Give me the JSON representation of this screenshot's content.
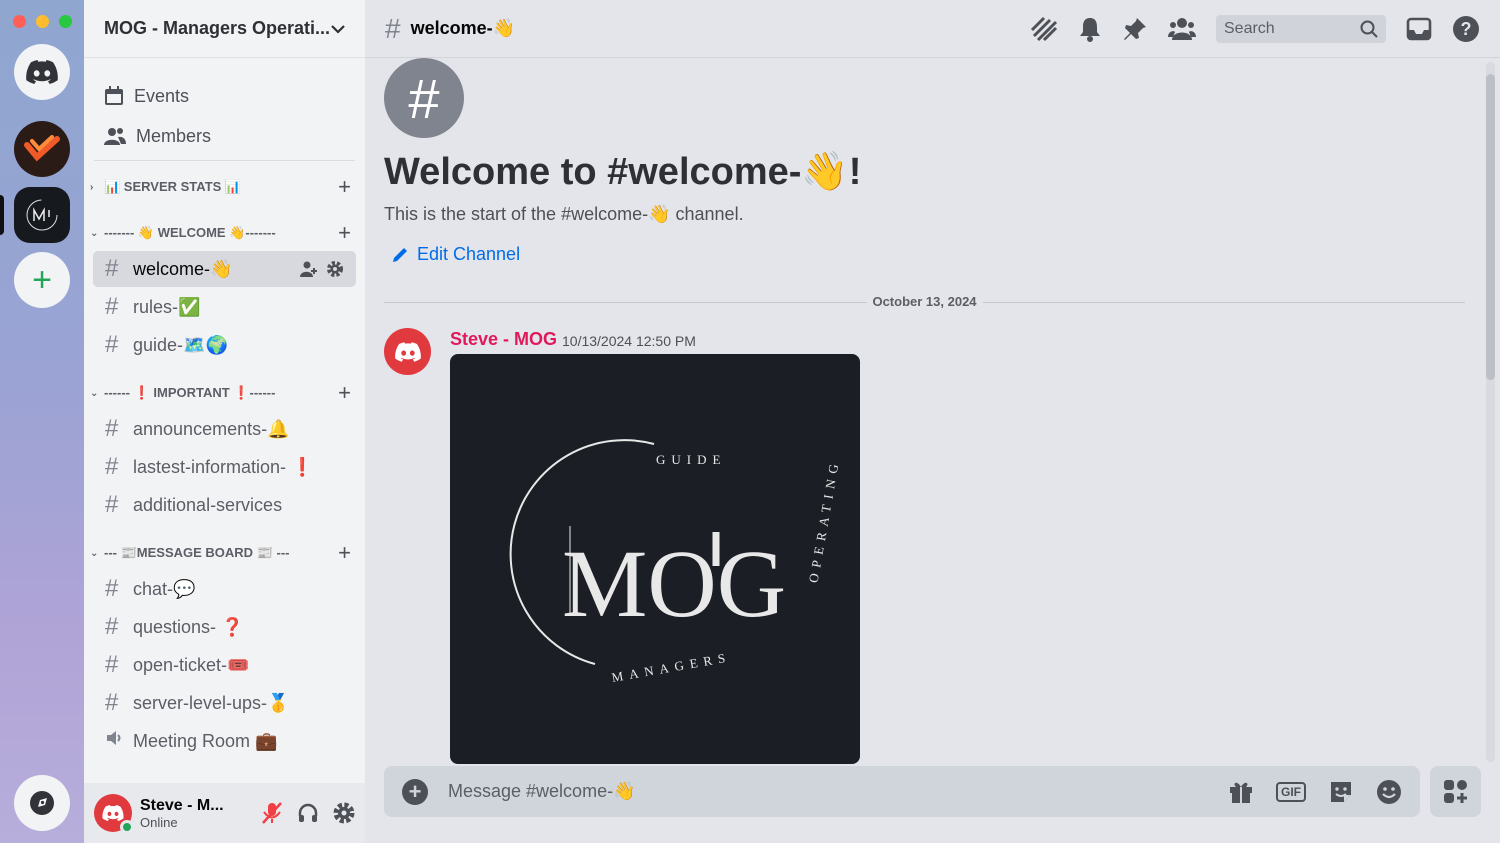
{
  "server": {
    "name": "MOG - Managers Operati..."
  },
  "sidebar": {
    "links": [
      {
        "label": "Events",
        "icon": "calendar-icon"
      },
      {
        "label": "Members",
        "icon": "members-icon"
      }
    ],
    "categories": [
      {
        "label": "📊 SERVER STATS 📊",
        "collapsed": true,
        "channels": []
      },
      {
        "label": "------- 👋 WELCOME 👋-------",
        "collapsed": false,
        "channels": [
          {
            "label": "welcome-👋",
            "active": true
          },
          {
            "label": "rules-✅"
          },
          {
            "label": "guide-🗺️🌍"
          }
        ]
      },
      {
        "label": "------ ❗ IMPORTANT ❗------",
        "collapsed": false,
        "channels": [
          {
            "label": "announcements-🔔"
          },
          {
            "label": "lastest-information- ❗"
          },
          {
            "label": "additional-services"
          }
        ]
      },
      {
        "label": "--- 📰MESSAGE BOARD 📰 ---",
        "collapsed": false,
        "channels": [
          {
            "label": "chat-💬"
          },
          {
            "label": "questions- ❓"
          },
          {
            "label": "open-ticket-🎟️"
          },
          {
            "label": "server-level-ups-🥇"
          },
          {
            "label": "Meeting Room 💼",
            "voice": true
          }
        ]
      }
    ]
  },
  "user": {
    "name": "Steve - M...",
    "status": "Online"
  },
  "topbar": {
    "channel": "welcome-👋",
    "search_placeholder": "Search"
  },
  "welcome": {
    "title": "Welcome to #welcome-👋!",
    "subtitle": "This is the start of the #welcome-👋 channel.",
    "edit": "Edit Channel"
  },
  "messages": {
    "date": "October 13, 2024",
    "author": "Steve - MOG",
    "time": "10/13/2024 12:50 PM",
    "image_text": {
      "ring_top": "GUIDE",
      "ring_right": "OPERATING",
      "ring_bottom": "MANAGERS",
      "logo": "MOG"
    }
  },
  "composer": {
    "placeholder": "Message #welcome-👋"
  },
  "colors": {
    "accent": "#006ce7",
    "author": "#e0195b",
    "online": "#23a559"
  }
}
